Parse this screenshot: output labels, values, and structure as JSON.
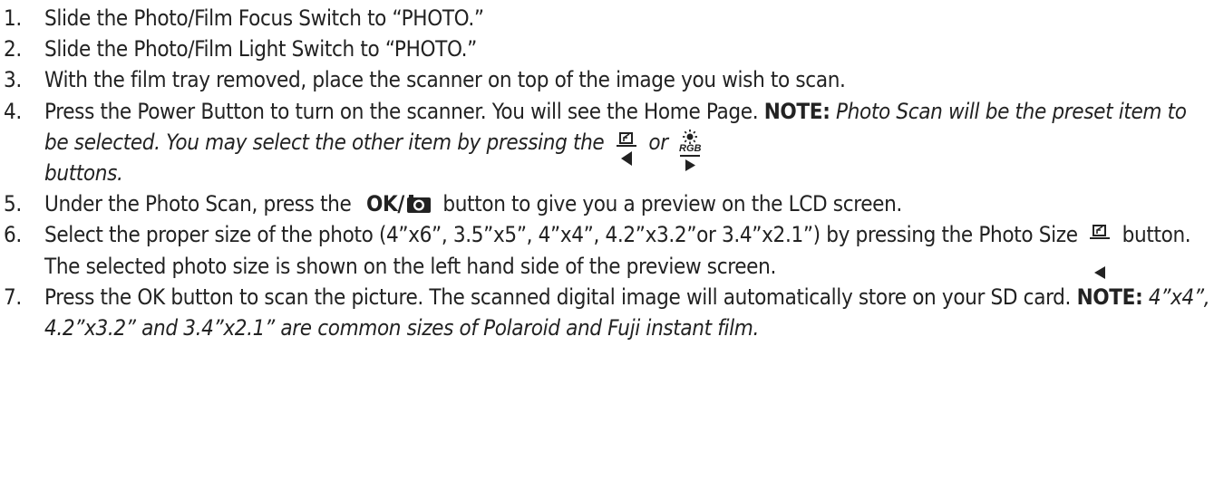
{
  "steps": [
    {
      "num": "1.",
      "text": "Slide the Photo/Film Focus Switch to “PHOTO.”"
    },
    {
      "num": "2.",
      "text": "Slide the Photo/Film Light Switch to “PHOTO.”"
    },
    {
      "num": "3.",
      "text": "With the film tray removed, place the scanner on top of the image you wish to scan."
    },
    {
      "num": "4.",
      "text_a": "Press the Power Button to turn on the scanner. You will see the Home Page. ",
      "note_label": "NOTE:",
      "note_a": " Photo Scan will be the preset item to be selected. You may select the other item by pressing the ",
      "note_or": " or ",
      "note_b": "buttons.",
      "rgb_label": "RGB"
    },
    {
      "num": "5.",
      "text_a": "Under the Photo Scan, press the ",
      "ok_label": "OK/",
      "text_b": " button to give you a preview on the LCD screen."
    },
    {
      "num": "6.",
      "text_a": "Select the proper size of the photo (4”x6”, 3.5”x5”, 4”x4”, 4.2”x3.2”or 3.4”x2.1”) by pressing the Photo Size ",
      "text_b": " button. The selected photo size is shown on the left hand side of the preview screen."
    },
    {
      "num": "7.",
      "text_a": "Press the OK button to scan the picture. The scanned digital image will automatically store on your SD card. ",
      "note_label": "NOTE:",
      "note": " 4”x4”, 4.2”x3.2” and 3.4”x2.1” are common sizes of Polaroid and Fuji instant film."
    }
  ],
  "icons": {
    "photo_size_left": "photo-size-left-arrow-icon",
    "light_rgb_right": "light-rgb-right-arrow-icon",
    "camera": "camera-icon"
  }
}
